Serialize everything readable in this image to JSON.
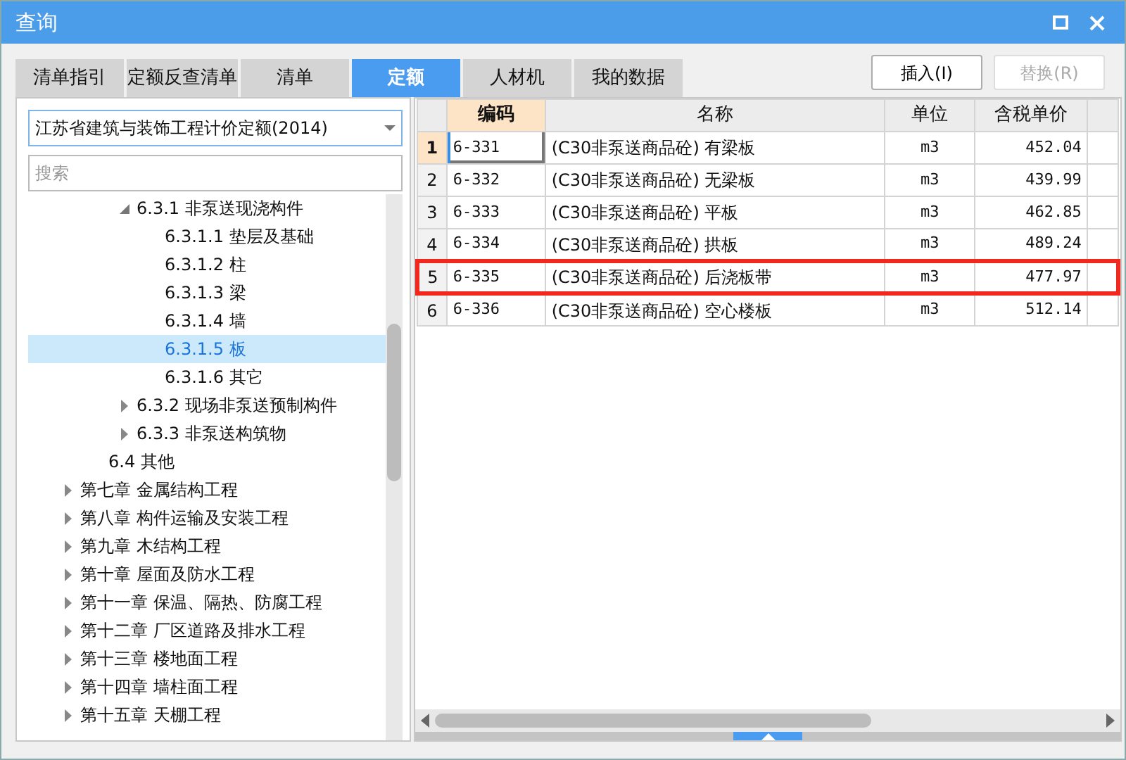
{
  "window": {
    "title": "查询"
  },
  "tabs": [
    {
      "label": "清单指引",
      "selected": false
    },
    {
      "label": "定额反查清单",
      "selected": false
    },
    {
      "label": "清单",
      "selected": false
    },
    {
      "label": "定额",
      "selected": true
    },
    {
      "label": "人材机",
      "selected": false
    },
    {
      "label": "我的数据",
      "selected": false
    }
  ],
  "buttons": [
    {
      "label": "插入(I)",
      "disabled": false
    },
    {
      "label": "替换(R)",
      "disabled": true
    }
  ],
  "library_select": {
    "value": "江苏省建筑与装饰工程计价定额(2014)"
  },
  "search": {
    "placeholder": "搜索"
  },
  "tree": {
    "items": [
      {
        "kind": "continued",
        "children": [
          {
            "kind": "continued",
            "children": [
              {
                "kind": "node",
                "label": "6.3.1 非泵送现浇构件",
                "expanded": true,
                "selected": false,
                "children": [
                  {
                    "kind": "node",
                    "label": "6.3.1.1 垫层及基础",
                    "selected": false
                  },
                  {
                    "kind": "node",
                    "label": "6.3.1.2 柱",
                    "selected": false
                  },
                  {
                    "kind": "node",
                    "label": "6.3.1.3 梁",
                    "selected": false
                  },
                  {
                    "kind": "node",
                    "label": "6.3.1.4 墙",
                    "selected": false
                  },
                  {
                    "kind": "node",
                    "label": "6.3.1.5 板",
                    "selected": true
                  },
                  {
                    "kind": "node",
                    "label": "6.3.1.6 其它",
                    "selected": false
                  }
                ]
              },
              {
                "kind": "node",
                "label": "6.3.2 现场非泵送预制构件",
                "expanded": false,
                "selected": false
              },
              {
                "kind": "node",
                "label": "6.3.3 非泵送构筑物",
                "expanded": false,
                "selected": false
              }
            ]
          },
          {
            "kind": "node",
            "label": "6.4 其他",
            "selected": false
          }
        ]
      },
      {
        "kind": "node",
        "label": "第七章  金属结构工程",
        "expanded": false,
        "selected": false
      },
      {
        "kind": "node",
        "label": "第八章  构件运输及安装工程",
        "expanded": false,
        "selected": false
      },
      {
        "kind": "node",
        "label": "第九章  木结构工程",
        "expanded": false,
        "selected": false
      },
      {
        "kind": "node",
        "label": "第十章  屋面及防水工程",
        "expanded": false,
        "selected": false
      },
      {
        "kind": "node",
        "label": "第十一章  保温、隔热、防腐工程",
        "expanded": false,
        "selected": false
      },
      {
        "kind": "node",
        "label": "第十二章  厂区道路及排水工程",
        "expanded": false,
        "selected": false
      },
      {
        "kind": "node",
        "label": "第十三章  楼地面工程",
        "expanded": false,
        "selected": false
      },
      {
        "kind": "node",
        "label": "第十四章  墙柱面工程",
        "expanded": false,
        "selected": false
      },
      {
        "kind": "node",
        "label": "第十五章  天棚工程",
        "expanded": false,
        "selected": false
      }
    ]
  },
  "table": {
    "columns": [
      "编码",
      "名称",
      "单位",
      "含税单价"
    ],
    "rows": [
      {
        "number": "1",
        "code": "6-331",
        "name": "(C30非泵送商品砼) 有梁板",
        "unit": "m3",
        "price": "452.04",
        "selected": true,
        "highlighted": false
      },
      {
        "number": "2",
        "code": "6-332",
        "name": "(C30非泵送商品砼) 无梁板",
        "unit": "m3",
        "price": "439.99",
        "selected": false,
        "highlighted": false
      },
      {
        "number": "3",
        "code": "6-333",
        "name": "(C30非泵送商品砼) 平板",
        "unit": "m3",
        "price": "462.85",
        "selected": false,
        "highlighted": false
      },
      {
        "number": "4",
        "code": "6-334",
        "name": "(C30非泵送商品砼) 拱板",
        "unit": "m3",
        "price": "489.24",
        "selected": false,
        "highlighted": false
      },
      {
        "number": "5",
        "code": "6-335",
        "name": "(C30非泵送商品砼) 后浇板带",
        "unit": "m3",
        "price": "477.97",
        "selected": false,
        "highlighted": true
      },
      {
        "number": "6",
        "code": "6-336",
        "name": "(C30非泵送商品砼) 空心楼板",
        "unit": "m3",
        "price": "512.14",
        "selected": false,
        "highlighted": false
      }
    ]
  }
}
